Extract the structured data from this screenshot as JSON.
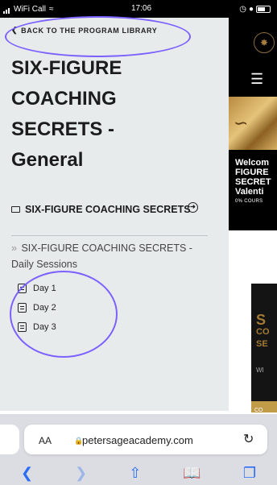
{
  "status_bar": {
    "carrier": "WiFi Call",
    "time": "17:06"
  },
  "nav": {
    "back_label": "BACK TO THE PROGRAM LIBRARY"
  },
  "course": {
    "title_line1": "SIX-FIGURE",
    "title_line2": "COACHING",
    "title_line3": "SECRETS -",
    "title_line4": "General"
  },
  "section": {
    "title": "SIX-FIGURE COACHING SECRETS",
    "subsection": "SIX-FIGURE COACHING SECRETS - Daily Sessions",
    "lessons": [
      "Day 1",
      "Day 2",
      "Day 3"
    ]
  },
  "background_site": {
    "line1": "Welcom",
    "line2": "FIGURE",
    "line3": "SECRET",
    "line4": "Valenti",
    "progress": "0% COURS",
    "card_big": "S",
    "card_l1": "CO",
    "card_l2": "SE",
    "card_small": "WI",
    "card_bar": "CO"
  },
  "browser": {
    "aa_label": "AA",
    "url": "petersageacademy.com"
  },
  "icons": {
    "back": "chevron-left-icon",
    "folder": "folder-icon",
    "collapse": "arrow-circle-icon",
    "lesson": "document-icon",
    "menu": "hamburger-icon",
    "reload": "reload-icon"
  },
  "colors": {
    "annotation": "#7b61ff",
    "panel_bg": "#e7ebec",
    "safari_blue": "#2b6df6"
  }
}
